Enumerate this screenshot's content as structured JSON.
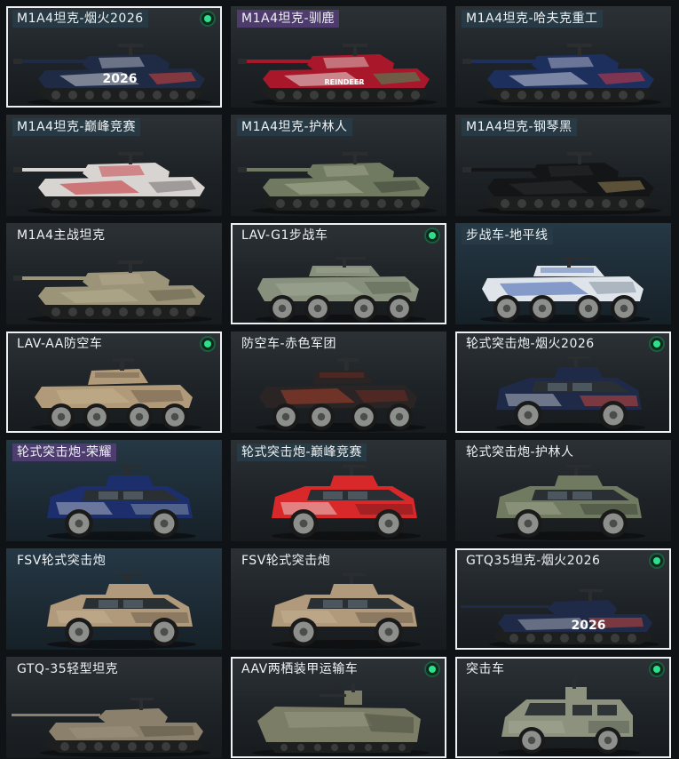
{
  "vehicles": [
    {
      "name": "M1A4坦克-烟火2026",
      "kind": "tank",
      "selected": true,
      "owned": true,
      "label_tone": "teal",
      "bg": "dark",
      "palette": {
        "body": "#1f2a44",
        "accent": "#c8cdd6",
        "detail": "#c4433a"
      },
      "decal": "2026"
    },
    {
      "name": "M1A4坦克-驯鹿",
      "kind": "tank",
      "selected": false,
      "owned": false,
      "label_tone": "violet",
      "bg": "dark",
      "palette": {
        "body": "#a8182a",
        "accent": "#e6e2dc",
        "detail": "#4a8a5a"
      },
      "decal": "REINDEER"
    },
    {
      "name": "M1A4坦克-哈夫克重工",
      "kind": "tank",
      "selected": false,
      "owned": false,
      "label_tone": "teal",
      "bg": "dark",
      "palette": {
        "body": "#1d2f5c",
        "accent": "#c9cde0",
        "detail": "#c23a4a"
      },
      "decal": ""
    },
    {
      "name": "M1A4坦克-巅峰竞赛",
      "kind": "tank",
      "selected": false,
      "owned": false,
      "label_tone": "teal",
      "bg": "dark",
      "palette": {
        "body": "#d8d4d2",
        "accent": "#c4282e",
        "detail": "#7c7476"
      },
      "decal": ""
    },
    {
      "name": "M1A4坦克-护林人",
      "kind": "tank",
      "selected": false,
      "owned": false,
      "label_tone": "teal",
      "bg": "dark",
      "palette": {
        "body": "#6f7a61",
        "accent": "#a7ad93",
        "detail": "#3f4739"
      },
      "decal": ""
    },
    {
      "name": "M1A4坦克-钢琴黑",
      "kind": "tank",
      "selected": false,
      "owned": false,
      "label_tone": "teal",
      "bg": "dark",
      "palette": {
        "body": "#141516",
        "accent": "#2c2e30",
        "detail": "#8b7a52"
      },
      "decal": ""
    },
    {
      "name": "M1A4主战坦克",
      "kind": "tank",
      "selected": false,
      "owned": false,
      "label_tone": "plain",
      "bg": "dark",
      "palette": {
        "body": "#9c9478",
        "accent": "#b7ae92",
        "detail": "#6c6652"
      },
      "decal": ""
    },
    {
      "name": "LAV-G1步战车",
      "kind": "wheeled8",
      "selected": true,
      "owned": true,
      "label_tone": "plain",
      "bg": "dark",
      "palette": {
        "body": "#87907c",
        "accent": "#a3ab98",
        "detail": "#55604e"
      },
      "decal": ""
    },
    {
      "name": "步战车-地平线",
      "kind": "wheeled8",
      "selected": false,
      "owned": false,
      "label_tone": "teal",
      "bg": "blue",
      "palette": {
        "body": "#dfe4ea",
        "accent": "#2a52a8",
        "detail": "#7a8797"
      },
      "decal": ""
    },
    {
      "name": "LAV-AA防空车",
      "kind": "aa",
      "selected": true,
      "owned": true,
      "label_tone": "plain",
      "bg": "dark",
      "palette": {
        "body": "#b19a79",
        "accent": "#c7b491",
        "detail": "#6f5f4a"
      },
      "decal": ""
    },
    {
      "name": "防空车-赤色军团",
      "kind": "aa",
      "selected": false,
      "owned": false,
      "label_tone": "plain",
      "bg": "dark",
      "palette": {
        "body": "#2a2424",
        "accent": "#b5412a",
        "detail": "#6e2a22"
      },
      "decal": ""
    },
    {
      "name": "轮式突击炮-烟火2026",
      "kind": "suv",
      "selected": true,
      "owned": true,
      "label_tone": "plain",
      "bg": "dark",
      "palette": {
        "body": "#1f2a48",
        "accent": "#cfd4dc",
        "detail": "#c4433a"
      },
      "decal": ""
    },
    {
      "name": "轮式突击炮-荣耀",
      "kind": "suv",
      "selected": false,
      "owned": false,
      "label_tone": "violet",
      "bg": "blue",
      "palette": {
        "body": "#1c2f6c",
        "accent": "#c9ced8",
        "detail": "#7f8ea6"
      },
      "decal": ""
    },
    {
      "name": "轮式突击炮-巅峰竞赛",
      "kind": "suv",
      "selected": false,
      "owned": false,
      "label_tone": "teal",
      "bg": "dark",
      "palette": {
        "body": "#d8282a",
        "accent": "#eeeeee",
        "detail": "#7a1a1c"
      },
      "decal": ""
    },
    {
      "name": "轮式突击炮-护林人",
      "kind": "suv",
      "selected": false,
      "owned": false,
      "label_tone": "plain",
      "bg": "dark",
      "palette": {
        "body": "#6f7a61",
        "accent": "#a7ad93",
        "detail": "#3f4739"
      },
      "decal": ""
    },
    {
      "name": "FSV轮式突击炮",
      "kind": "suv",
      "selected": false,
      "owned": false,
      "label_tone": "plain",
      "bg": "blue",
      "palette": {
        "body": "#b19a7c",
        "accent": "#c9b696",
        "detail": "#6d5e4b"
      },
      "decal": ""
    },
    {
      "name": "FSV轮式突击炮",
      "kind": "suv",
      "selected": false,
      "owned": false,
      "label_tone": "plain",
      "bg": "dark",
      "palette": {
        "body": "#b19a7c",
        "accent": "#c9b696",
        "detail": "#6d5e4b"
      },
      "decal": ""
    },
    {
      "name": "GTQ35坦克-烟火2026",
      "kind": "light",
      "selected": true,
      "owned": true,
      "label_tone": "plain",
      "bg": "dark",
      "palette": {
        "body": "#1f2a48",
        "accent": "#cfd4dc",
        "detail": "#c4433a"
      },
      "decal": "2026"
    },
    {
      "name": "GTQ-35轻型坦克",
      "kind": "light",
      "selected": false,
      "owned": false,
      "label_tone": "plain",
      "bg": "dark",
      "palette": {
        "body": "#8a806c",
        "accent": "#a69b84",
        "detail": "#5c5546"
      },
      "decal": ""
    },
    {
      "name": "AAV两栖装甲运输车",
      "kind": "aav",
      "selected": true,
      "owned": true,
      "label_tone": "plain",
      "bg": "dark",
      "palette": {
        "body": "#7b7d66",
        "accent": "#9a9c84",
        "detail": "#4f5142"
      },
      "decal": ""
    },
    {
      "name": "突击车",
      "kind": "van",
      "selected": true,
      "owned": true,
      "label_tone": "plain",
      "bg": "dark",
      "palette": {
        "body": "#8c927e",
        "accent": "#a9ae9b",
        "detail": "#565c4d"
      },
      "decal": ""
    }
  ]
}
